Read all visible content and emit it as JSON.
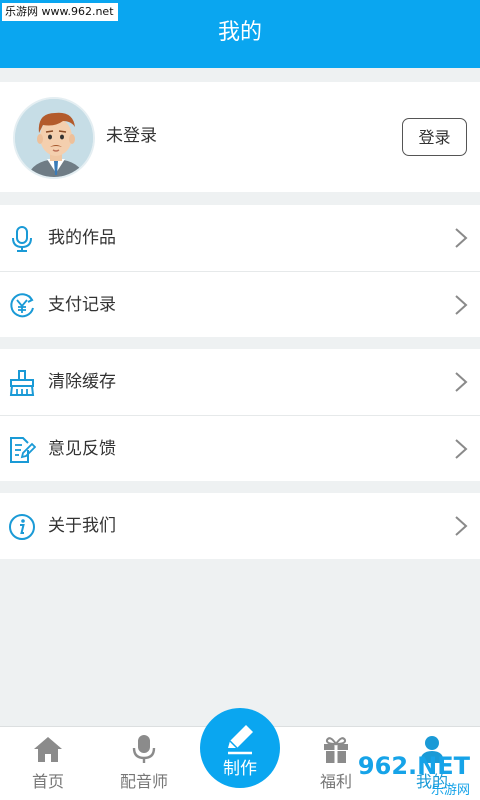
{
  "watermark": "乐游网 www.962.net",
  "header": {
    "title": "我的"
  },
  "profile": {
    "username": "未登录",
    "login_label": "登录"
  },
  "menu_groups": [
    {
      "items": [
        {
          "label": "我的作品",
          "icon": "microphone-icon"
        },
        {
          "label": "支付记录",
          "icon": "yen-payment-icon"
        }
      ]
    },
    {
      "items": [
        {
          "label": "清除缓存",
          "icon": "broom-icon"
        },
        {
          "label": "意见反馈",
          "icon": "feedback-edit-icon"
        }
      ]
    },
    {
      "items": [
        {
          "label": "关于我们",
          "icon": "info-icon"
        }
      ]
    }
  ],
  "tabs": [
    {
      "label": "首页",
      "icon": "home-icon"
    },
    {
      "label": "配音师",
      "icon": "microphone-icon"
    },
    {
      "label": "制作",
      "icon": "pencil-icon"
    },
    {
      "label": "福利",
      "icon": "gift-icon"
    },
    {
      "label": "我的",
      "icon": "person-icon",
      "active": true
    }
  ],
  "brand": {
    "logo_text": "962.NET",
    "sub_text": "乐游网"
  },
  "colors": {
    "accent": "#0aa6f0",
    "icon_blue": "#1a9ad6",
    "background": "#eef1f2"
  }
}
